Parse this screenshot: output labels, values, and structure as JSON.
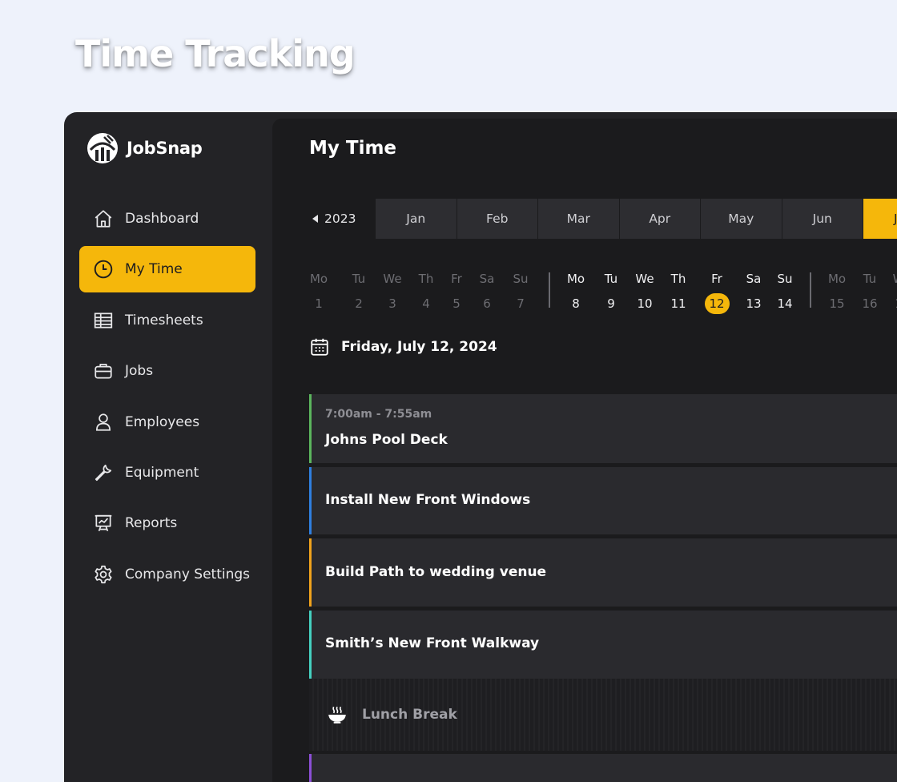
{
  "page_heading": "Time Tracking",
  "brand": {
    "name": "JobSnap",
    "logo_icon": "jobsnap-logo-icon"
  },
  "colors": {
    "accent": "#f5b70b",
    "sidebar_bg": "#232326",
    "main_bg": "#1b1b1d",
    "card_bg": "#2a2a2e"
  },
  "sidebar": {
    "items": [
      {
        "label": "Dashboard",
        "icon": "home-icon",
        "active": false
      },
      {
        "label": "My Time",
        "icon": "clock-icon",
        "active": true
      },
      {
        "label": "Timesheets",
        "icon": "table-icon",
        "active": false
      },
      {
        "label": "Jobs",
        "icon": "briefcase-icon",
        "active": false
      },
      {
        "label": "Employees",
        "icon": "user-icon",
        "active": false
      },
      {
        "label": "Equipment",
        "icon": "wrench-icon",
        "active": false
      },
      {
        "label": "Reports",
        "icon": "presentation-chart-icon",
        "active": false
      },
      {
        "label": "Company Settings",
        "icon": "gear-icon",
        "active": false
      }
    ]
  },
  "main": {
    "title": "My Time",
    "year_nav": "2023",
    "months": [
      "Jan",
      "Feb",
      "Mar",
      "Apr",
      "May",
      "Jun",
      "J"
    ],
    "active_month_index": 6,
    "weeks": [
      {
        "days": [
          [
            "Mo",
            "1"
          ],
          [
            "Tu",
            "2"
          ],
          [
            "We",
            "3"
          ],
          [
            "Th",
            "4"
          ],
          [
            "Fr",
            "5"
          ],
          [
            "Sa",
            "6"
          ],
          [
            "Su",
            "7"
          ]
        ]
      },
      {
        "days": [
          [
            "Mo",
            "8"
          ],
          [
            "Tu",
            "9"
          ],
          [
            "We",
            "10"
          ],
          [
            "Th",
            "11"
          ],
          [
            "Fr",
            "12"
          ],
          [
            "Sa",
            "13"
          ],
          [
            "Su",
            "14"
          ]
        ]
      },
      {
        "days": [
          [
            "Mo",
            "15"
          ],
          [
            "Tu",
            "16"
          ],
          [
            "W",
            "1"
          ]
        ]
      }
    ],
    "selected_day": "12",
    "date_label": "Friday, July 12, 2024",
    "entries": [
      {
        "time": "7:00am - 7:55am",
        "name": "Johns Pool Deck",
        "color": "#5bb55d"
      },
      {
        "time": "",
        "name": "Install New Front Windows",
        "color": "#2f7fdf"
      },
      {
        "time": "",
        "name": "Build Path to wedding venue",
        "color": "#f0a21c"
      },
      {
        "time": "",
        "name": "Smith’s New Front Walkway",
        "color": "#45d1c0"
      }
    ],
    "break": {
      "label": "Lunch Break",
      "icon": "bowl-steam-icon"
    },
    "partial_entry_color": "#8c4fd6"
  }
}
